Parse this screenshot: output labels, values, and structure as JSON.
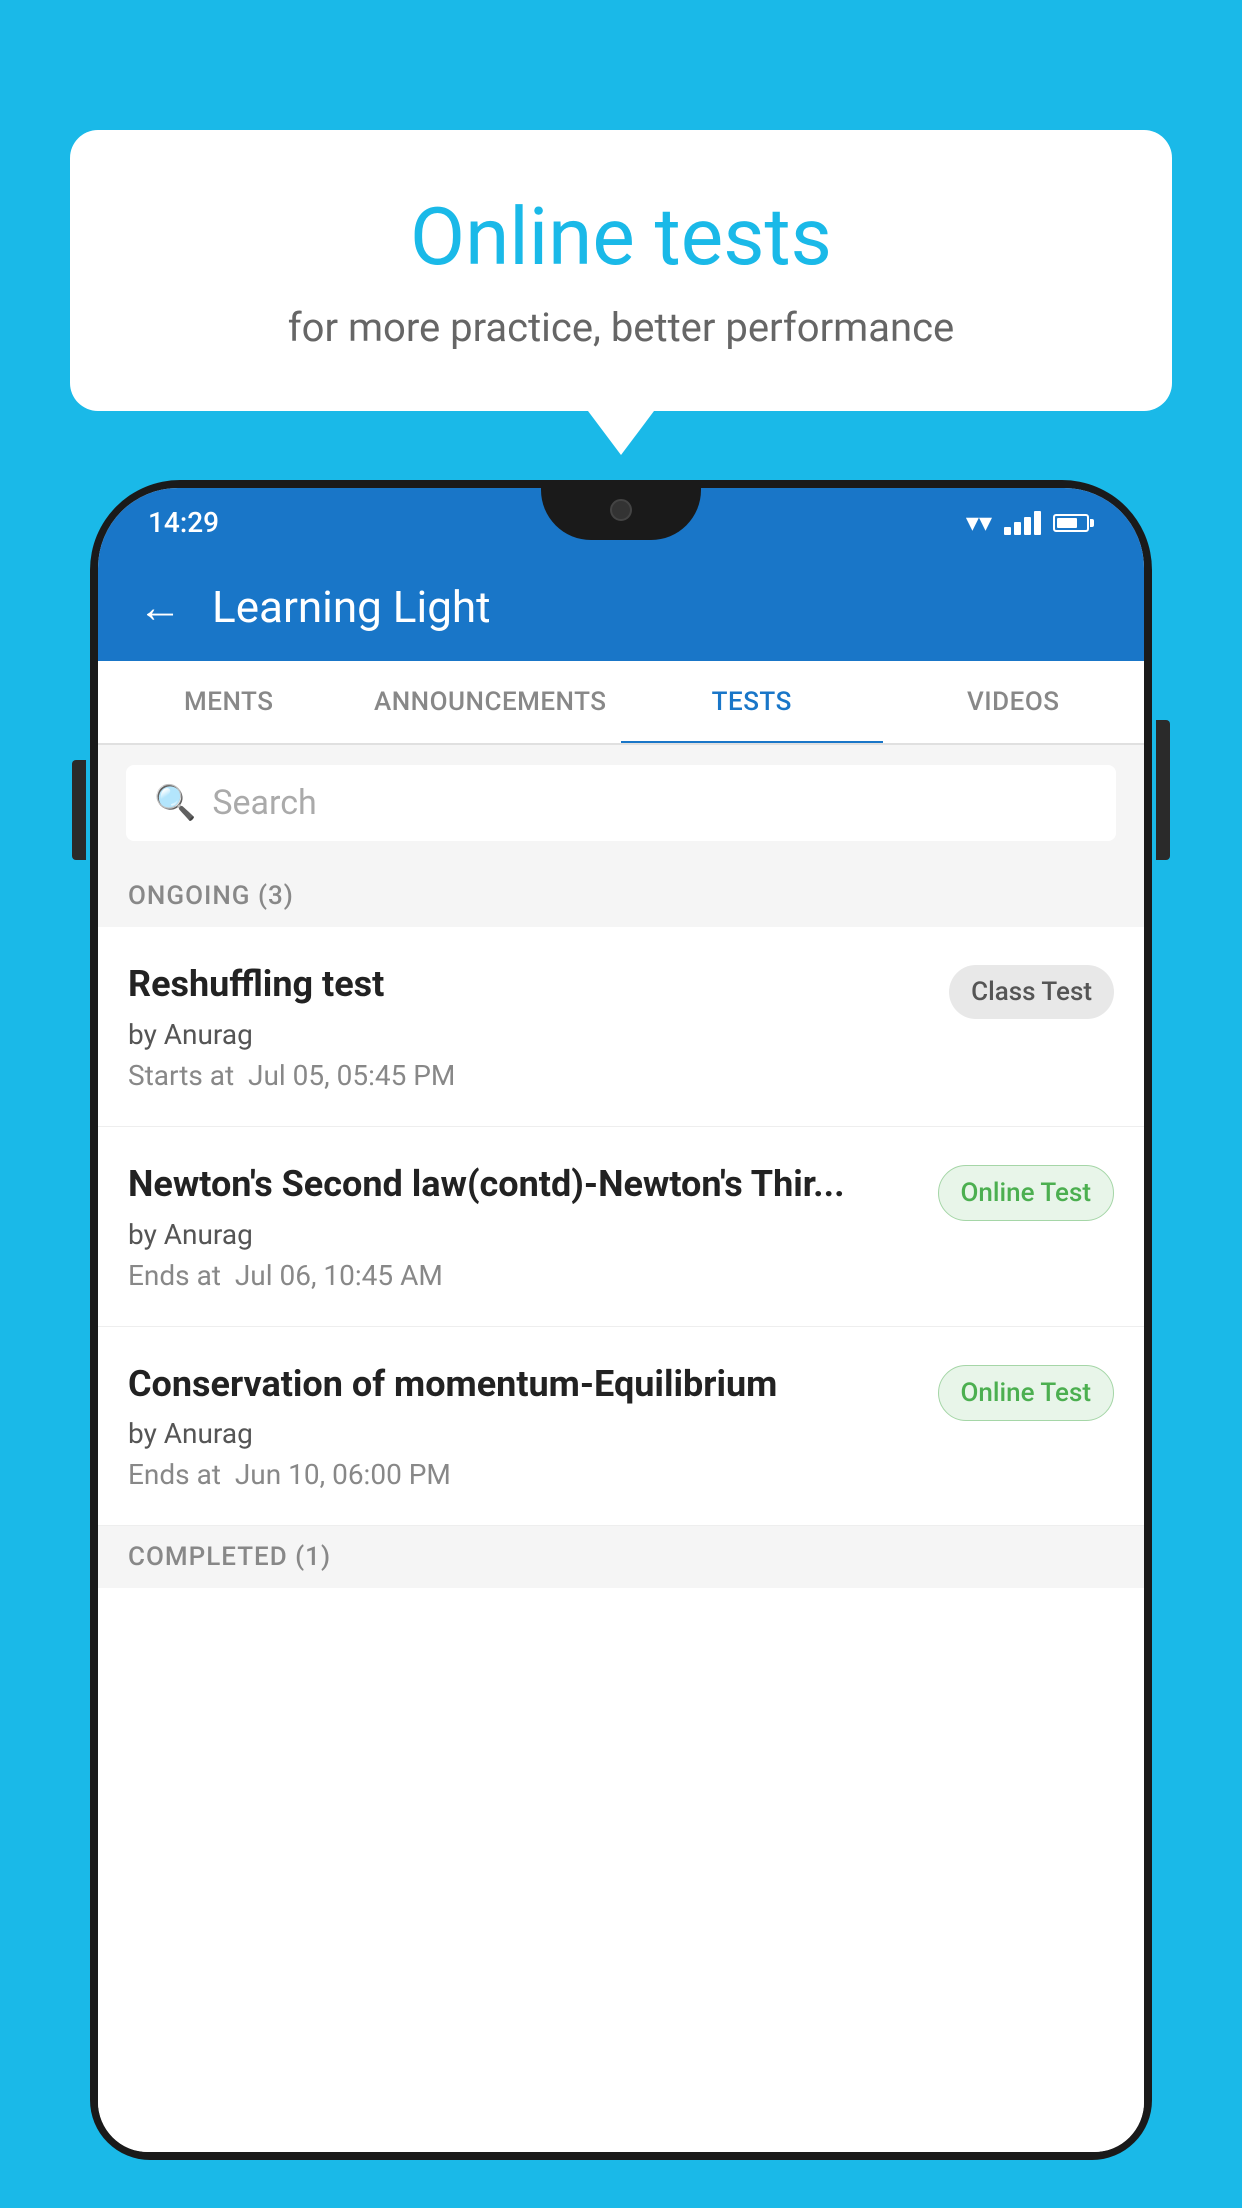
{
  "background_color": "#1ab9e8",
  "speech_bubble": {
    "title": "Online tests",
    "subtitle": "for more practice, better performance"
  },
  "phone": {
    "status_bar": {
      "time": "14:29",
      "icons": [
        "wifi",
        "signal",
        "battery"
      ]
    },
    "app_bar": {
      "title": "Learning Light",
      "back_button_label": "←"
    },
    "tabs": [
      {
        "label": "MENTS",
        "active": false
      },
      {
        "label": "ANNOUNCEMENTS",
        "active": false
      },
      {
        "label": "TESTS",
        "active": true
      },
      {
        "label": "VIDEOS",
        "active": false
      }
    ],
    "search": {
      "placeholder": "Search"
    },
    "sections": {
      "ongoing": {
        "label": "ONGOING (3)",
        "tests": [
          {
            "name": "Reshuffling test",
            "author": "by Anurag",
            "time_label": "Starts at",
            "time_value": "Jul 05, 05:45 PM",
            "badge_text": "Class Test",
            "badge_type": "class"
          },
          {
            "name": "Newton's Second law(contd)-Newton's Thir...",
            "author": "by Anurag",
            "time_label": "Ends at",
            "time_value": "Jul 06, 10:45 AM",
            "badge_text": "Online Test",
            "badge_type": "online"
          },
          {
            "name": "Conservation of momentum-Equilibrium",
            "author": "by Anurag",
            "time_label": "Ends at",
            "time_value": "Jun 10, 06:00 PM",
            "badge_text": "Online Test",
            "badge_type": "online"
          }
        ]
      },
      "completed": {
        "label": "COMPLETED (1)"
      }
    }
  }
}
